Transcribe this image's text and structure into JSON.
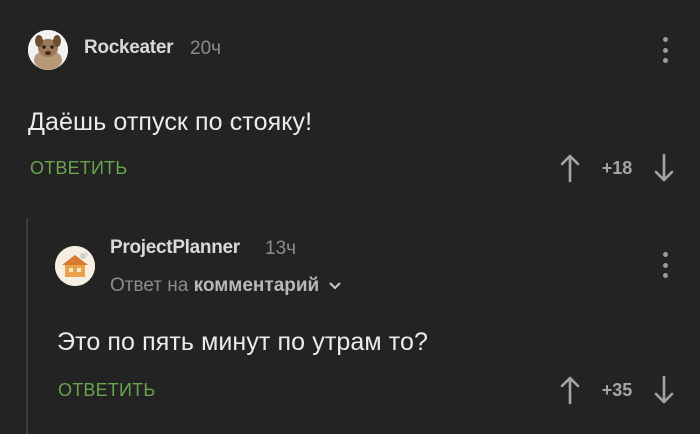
{
  "comments": [
    {
      "author": "Rockeater",
      "time": "20ч",
      "text": "Даёшь отпуск по стояку!",
      "reply_label": "ОТВЕТИТЬ",
      "score": "+18"
    },
    {
      "author": "ProjectPlanner",
      "time": "13ч",
      "reply_to_prefix": "Ответ на",
      "reply_to_target": "комментарий",
      "text": "Это по пять минут по утрам то?",
      "reply_label": "ОТВЕТИТЬ",
      "score": "+35"
    }
  ],
  "colors": {
    "background": "#232323",
    "accent": "#68a44c",
    "muted": "#8c8c8c"
  }
}
